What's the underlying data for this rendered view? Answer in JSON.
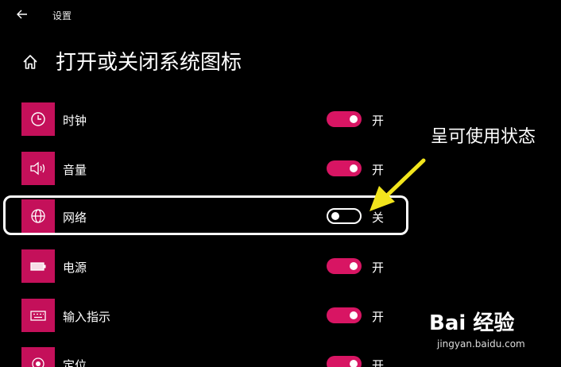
{
  "header": {
    "back_icon": "back-arrow-icon",
    "window_title": "设置"
  },
  "page": {
    "home_icon": "home-icon",
    "title": "打开或关闭系统图标"
  },
  "settings": [
    {
      "label": "时钟",
      "icon": "clock-icon",
      "on": true,
      "state": "开"
    },
    {
      "label": "音量",
      "icon": "volume-icon",
      "on": true,
      "state": "开"
    },
    {
      "label": "网络",
      "icon": "globe-icon",
      "on": false,
      "state": "关"
    },
    {
      "label": "电源",
      "icon": "battery-icon",
      "on": true,
      "state": "开"
    },
    {
      "label": "输入指示",
      "icon": "keyboard-icon",
      "on": true,
      "state": "开"
    },
    {
      "label": "定位",
      "icon": "location-icon",
      "on": true,
      "state": "开"
    }
  ],
  "annotation": {
    "text": "呈可使用状态"
  },
  "watermark": {
    "brand": "Bai 经验",
    "url": "jingyan.baidu.com"
  },
  "colors": {
    "accent": "#d81563",
    "icon_tile": "#c4105a",
    "background": "#000000",
    "annotation_arrow": "#f2e51d"
  }
}
